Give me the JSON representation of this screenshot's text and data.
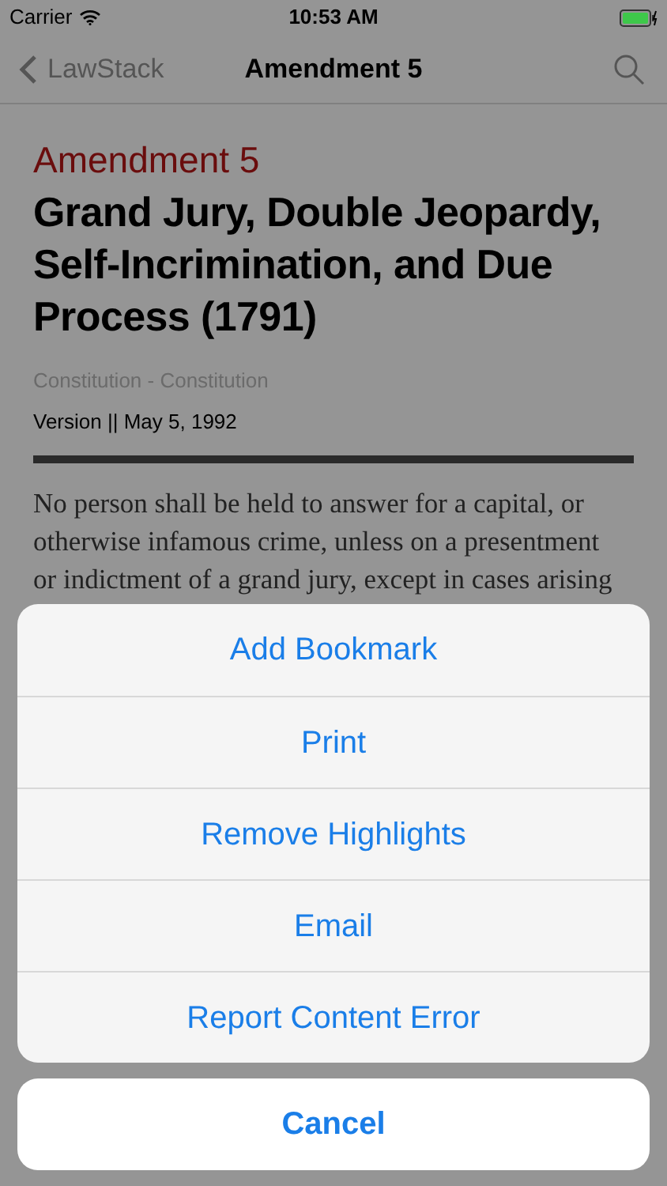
{
  "status_bar": {
    "carrier": "Carrier",
    "time": "10:53 AM"
  },
  "nav_bar": {
    "back": "LawStack",
    "title": "Amendment 5"
  },
  "document": {
    "number": "Amendment 5",
    "title": "Grand Jury, Double Jeopardy, Self-Incrimination, and Due Process (1791)",
    "source": "Constitution - Constitution",
    "version": "Version || May 5, 1992",
    "body_lines": [
      "No person shall be held to answer for a capital, or",
      "otherwise infamous crime, unless on a presentment",
      "or indictment of a grand jury, except in cases arising"
    ]
  },
  "action_sheet": {
    "actions": [
      "Add Bookmark",
      "Print",
      "Remove Highlights",
      "Email",
      "Report Content Error"
    ],
    "cancel": "Cancel"
  }
}
